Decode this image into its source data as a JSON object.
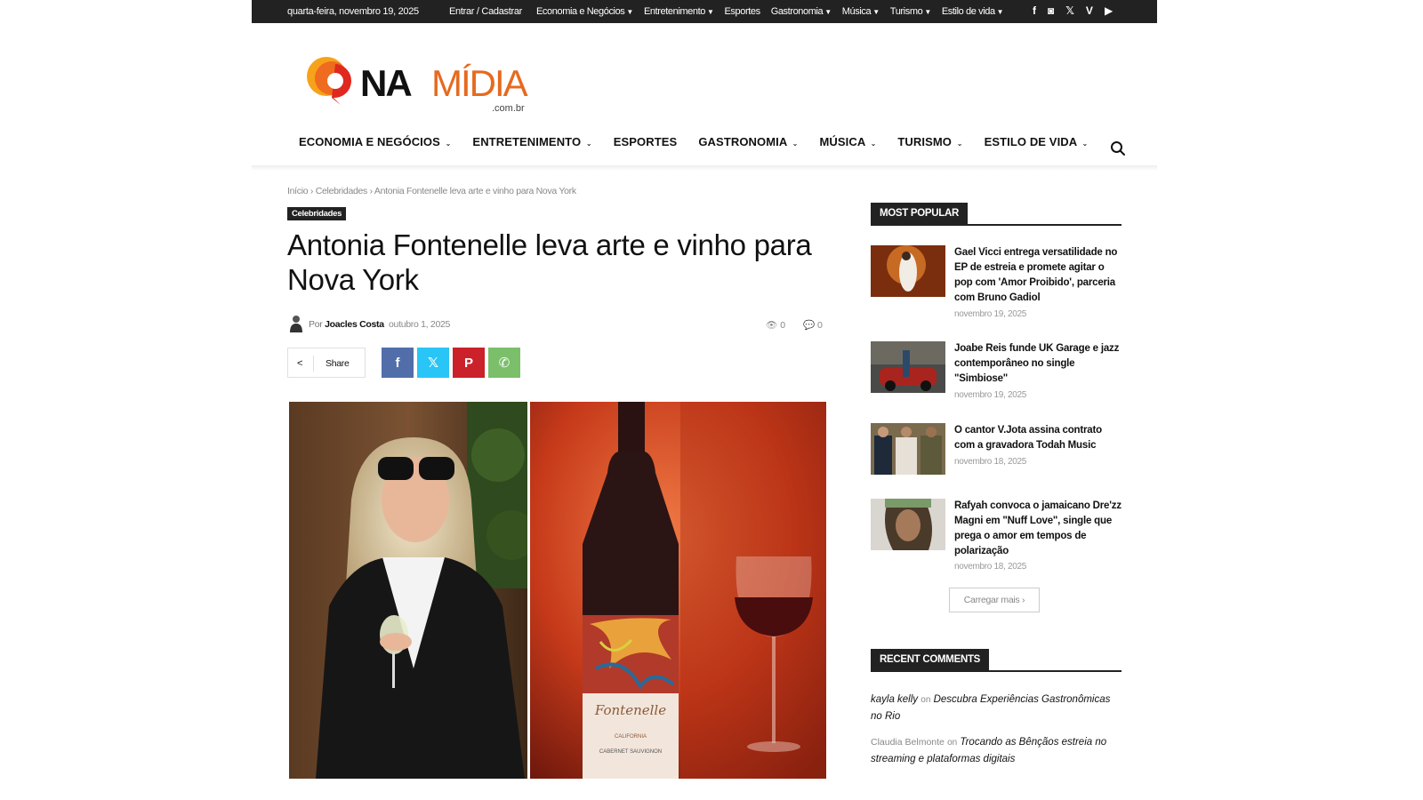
{
  "topbar": {
    "date": "quarta-feira, novembro 19, 2025",
    "login": "Entrar / Cadastrar",
    "menu": [
      "Economia e Negócios",
      "Entretenimento",
      "Esportes",
      "Gastronomia",
      "Música",
      "Turismo",
      "Estilo de vida"
    ],
    "social_icons": [
      "facebook-icon",
      "instagram-icon",
      "x-icon",
      "vimeo-icon",
      "youtube-icon"
    ]
  },
  "logo": {
    "na": "NA",
    "midia": "MÍDIA",
    "domain": ".com.br"
  },
  "nav": {
    "items": [
      "ECONOMIA E NEGÓCIOS",
      "ENTRETENIMENTO",
      "ESPORTES",
      "GASTRONOMIA",
      "MÚSICA",
      "TURISMO",
      "ESTILO DE VIDA"
    ],
    "has_dropdown": [
      true,
      true,
      false,
      true,
      true,
      true,
      true
    ]
  },
  "breadcrumb": {
    "home": "Início",
    "category": "Celebridades",
    "current": "Antonia Fontenelle leva arte e vinho para Nova York"
  },
  "article": {
    "category": "Celebridades",
    "title": "Antonia Fontenelle leva arte e vinho para Nova York",
    "by": "Por",
    "author": "Joacles Costa",
    "date": "outubro 1, 2025",
    "views": "0",
    "comments": "0",
    "share_label": "Share",
    "bottle_label": "Fontenelle",
    "bottle_region": "CALIFORNIA",
    "bottle_variety": "CABERNET SAUVIGNON"
  },
  "colors": {
    "facebook": "#516eab",
    "twitter": "#29c5f6",
    "pinterest": "#ca212a",
    "whatsapp": "#7bbf6a",
    "accent": "#e66a1f"
  },
  "sidebar": {
    "popular_heading": "MOST POPULAR",
    "popular": [
      {
        "title": "Gael Vicci entrega versatilidade no EP de estreia e promete agitar o pop com 'Amor Proibido', parceria com Bruno Gadiol",
        "date": "novembro 19, 2025"
      },
      {
        "title": "Joabe Reis funde UK Garage e jazz contemporâneo no single \"Simbiose\"",
        "date": "novembro 19, 2025"
      },
      {
        "title": "O cantor V.Jota assina contrato com a gravadora Todah Music",
        "date": "novembro 18, 2025"
      },
      {
        "title": "Rafyah convoca o jamaicano Dre'zz Magni em \"Nuff Love\", single que prega o amor em tempos de polarização",
        "date": "novembro 18, 2025"
      }
    ],
    "load_more": "Carregar mais",
    "comments_heading": "RECENT COMMENTS",
    "comments": [
      {
        "author": "kayla kelly",
        "on": "on",
        "post": "Descubra Experiências Gastronômicas no Rio"
      },
      {
        "author": "Claudia Belmonte",
        "on": "on",
        "post": "Trocando as Bênçãos estreia no streaming e plataformas digitais"
      }
    ]
  }
}
